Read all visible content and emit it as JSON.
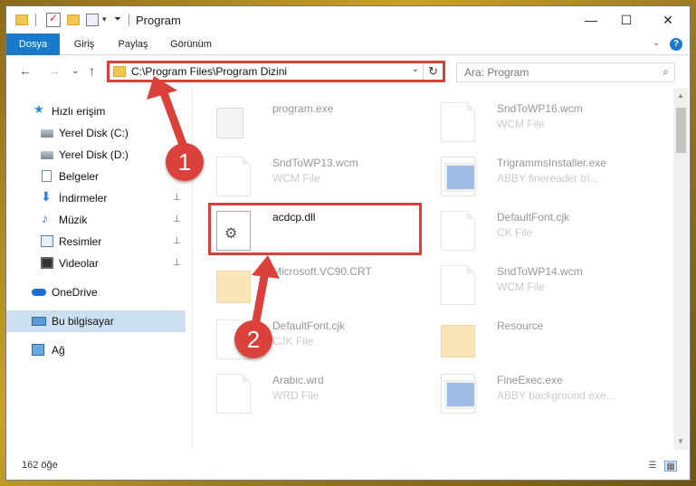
{
  "window": {
    "title": "Program",
    "controls": {
      "minimize": "—",
      "maximize": "☐",
      "close": "✕"
    }
  },
  "ribbon": {
    "tabs": [
      {
        "label": "Dosya",
        "active": true
      },
      {
        "label": "Giriş",
        "active": false
      },
      {
        "label": "Paylaş",
        "active": false
      },
      {
        "label": "Görünüm",
        "active": false
      }
    ],
    "help": "?"
  },
  "nav": {
    "back": "←",
    "forward": "→",
    "recent": "⌄",
    "up": "↑",
    "address": "C:\\Program Files\\Program Dizini",
    "refresh": "↻",
    "search_placeholder": "Ara: Program",
    "search_icon": "⌕"
  },
  "sidebar": {
    "items": [
      {
        "label": "Hızlı erişim",
        "icon": "star-icon",
        "pinned": false,
        "selected": false
      },
      {
        "label": "Yerel Disk (C:)",
        "icon": "disk-icon",
        "pinned": false,
        "selected": false
      },
      {
        "label": "Yerel Disk (D:)",
        "icon": "disk-icon",
        "pinned": false,
        "selected": false
      },
      {
        "label": "Belgeler",
        "icon": "documents-icon",
        "pinned": false,
        "selected": false
      },
      {
        "label": "İndirmeler",
        "icon": "download-icon",
        "pinned": true,
        "selected": false
      },
      {
        "label": "Müzik",
        "icon": "music-icon",
        "pinned": true,
        "selected": false
      },
      {
        "label": "Resimler",
        "icon": "pictures-icon",
        "pinned": true,
        "selected": false
      },
      {
        "label": "Videolar",
        "icon": "video-icon",
        "pinned": true,
        "selected": false
      },
      {
        "label": "OneDrive",
        "icon": "cloud-icon",
        "pinned": false,
        "selected": false
      },
      {
        "label": "Bu bilgisayar",
        "icon": "computer-icon",
        "pinned": false,
        "selected": true
      },
      {
        "label": "Ağ",
        "icon": "network-icon",
        "pinned": false,
        "selected": false
      }
    ],
    "pin_glyph": "📌"
  },
  "files": [
    {
      "name": "program.exe",
      "type": "",
      "icon": "setup-icon",
      "faded": true
    },
    {
      "name": "SndToWP16.wcm",
      "type": "WCM File",
      "icon": "document-icon",
      "faded": true
    },
    {
      "name": "SndToWP13.wcm",
      "type": "WCM File",
      "icon": "document-icon",
      "faded": true
    },
    {
      "name": "TrigrammsInstaller.exe",
      "type": "ABBY finereader tri...",
      "icon": "app-window-icon",
      "faded": true
    },
    {
      "name": "acdcp.dll",
      "type": "",
      "icon": "gear-file-icon",
      "faded": false
    },
    {
      "name": "DefaultFont.cjk",
      "type": "CK File",
      "icon": "document-icon",
      "faded": true
    },
    {
      "name": "Microsoft.VC90.CRT",
      "type": "",
      "icon": "folder-icon",
      "faded": true
    },
    {
      "name": "SndToWP14.wcm",
      "type": "WCM File",
      "icon": "document-icon",
      "faded": true
    },
    {
      "name": "DefaultFont.cjk",
      "type": "CJK File",
      "icon": "document-icon",
      "faded": true
    },
    {
      "name": "Resource",
      "type": "",
      "icon": "folder-icon",
      "faded": true
    },
    {
      "name": "Arabic.wrd",
      "type": "WRD File",
      "icon": "document-icon",
      "faded": true
    },
    {
      "name": "FineExec.exe",
      "type": "ABBY background exe...",
      "icon": "app-window-icon",
      "faded": true
    }
  ],
  "status": {
    "count": "162 öğe"
  },
  "annotations": {
    "badge1": "1",
    "badge2": "2",
    "color": "#d9413a"
  },
  "colors": {
    "accent": "#1979ca",
    "selection": "#cce0f2",
    "annotation": "#d9413a"
  }
}
